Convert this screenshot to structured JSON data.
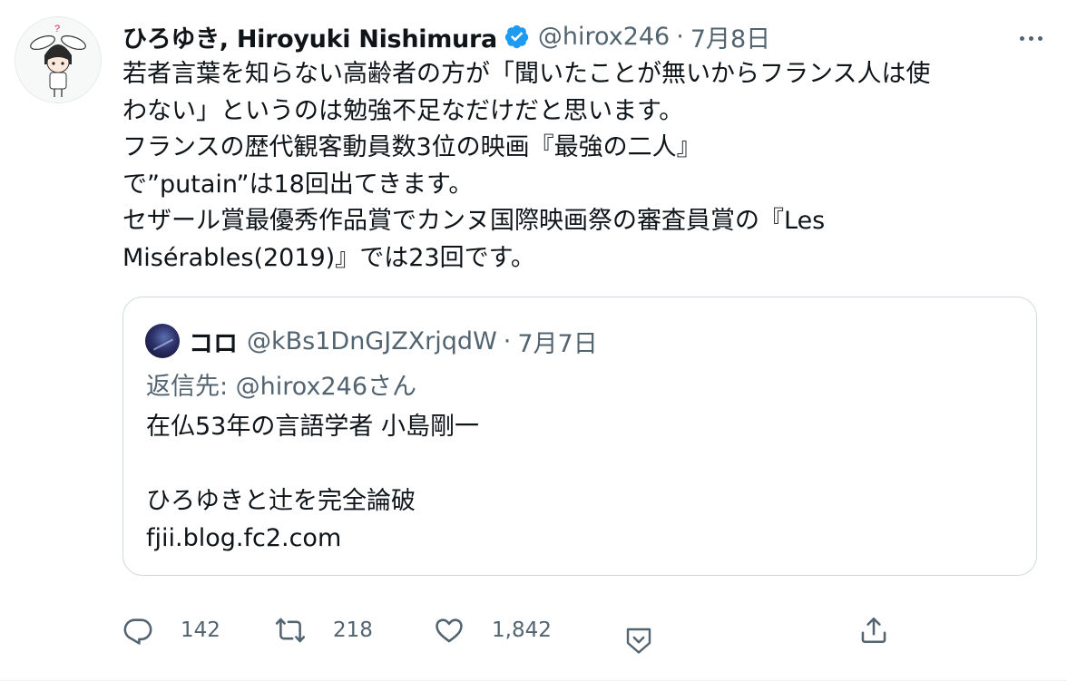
{
  "tweet": {
    "author": {
      "display_name": "ひろゆき, Hiroyuki Nishimura",
      "handle": "@hirox246",
      "verified": true
    },
    "date": "7月8日",
    "separator": "·",
    "text_lines": [
      "若者言葉を知らない高齢者の方が「聞いたことが無いからフランス人は使",
      "わない」というのは勉強不足なだけだと思います。",
      "フランスの歴代観客動員数3位の映画『最強の二人』",
      "で”putain”は18回出てきます。",
      "セザール賞最優秀作品賞でカンヌ国際映画祭の審査員賞の『Les",
      "Misérables(2019)』では23回です。"
    ]
  },
  "quoted": {
    "display_name": "コロ",
    "handle": "@kBs1DnGJZXrjqdW",
    "date": "7月7日",
    "reply_to": "返信先: @hirox246さん",
    "text_lines": [
      "在仏53年の言語学者 小島剛一",
      "",
      "ひろゆきと辻を完全論破",
      "fjii.blog.fc2.com"
    ]
  },
  "actions": {
    "reply_count": "142",
    "retweet_count": "218",
    "like_count": "1,842"
  },
  "icons": {
    "verified": "verified-badge-icon",
    "more": "more-options-icon",
    "reply": "reply-icon",
    "retweet": "retweet-icon",
    "like": "heart-icon",
    "react": "chevron-down-icon",
    "share": "share-icon"
  },
  "colors": {
    "verified": "#1d9bf0",
    "text": "#0f1419",
    "secondary": "#536471",
    "border": "#cfd9de"
  }
}
